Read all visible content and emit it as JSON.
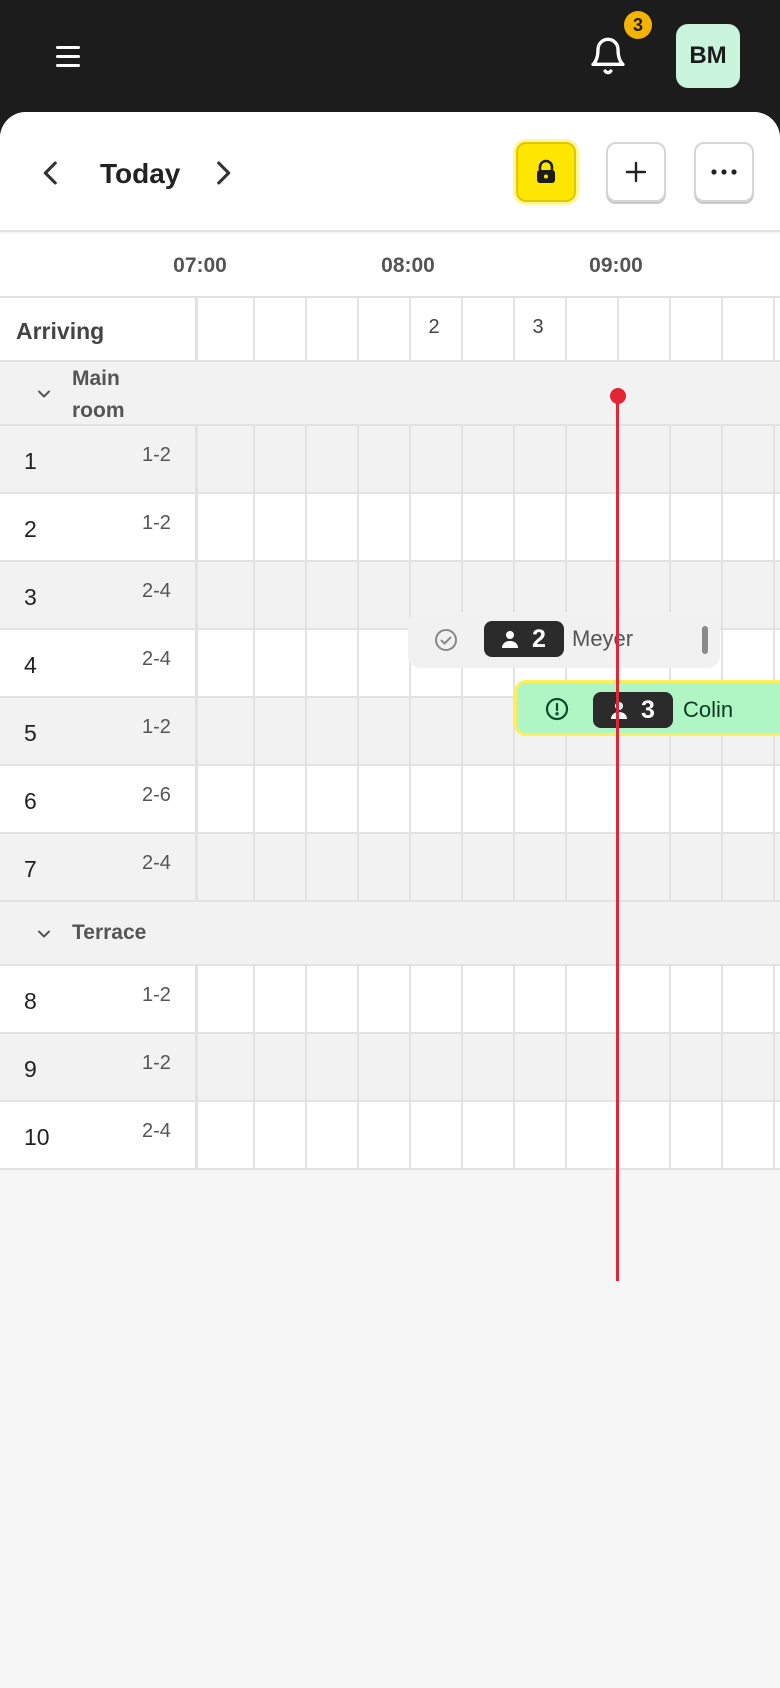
{
  "header": {
    "notification_count": "3",
    "avatar_initials": "BM"
  },
  "toolbar": {
    "date_label": "Today"
  },
  "timeline": {
    "times": [
      "07:00",
      "08:00",
      "09:00"
    ]
  },
  "arriving": {
    "label": "Arriving",
    "counts": [
      "2",
      "3"
    ]
  },
  "sections": [
    {
      "title_line1": "Main",
      "title_line2": "room",
      "tables": [
        {
          "name": "1",
          "capacity": "1-2"
        },
        {
          "name": "2",
          "capacity": "1-2"
        },
        {
          "name": "3",
          "capacity": "2-4"
        },
        {
          "name": "4",
          "capacity": "2-4"
        },
        {
          "name": "5",
          "capacity": "1-2"
        },
        {
          "name": "6",
          "capacity": "2-6"
        },
        {
          "name": "7",
          "capacity": "2-4"
        }
      ]
    },
    {
      "title_line1": "Terrace",
      "tables": [
        {
          "name": "8",
          "capacity": "1-2"
        },
        {
          "name": "9",
          "capacity": "1-2"
        },
        {
          "name": "10",
          "capacity": "2-4"
        }
      ]
    }
  ],
  "bookings": [
    {
      "guest_name": "Meyer",
      "guests": "2",
      "status_icon": "check-circle-icon"
    },
    {
      "guest_name": "Colin",
      "guests": "3",
      "status_icon": "alert-circle-icon"
    }
  ],
  "colors": {
    "accent_yellow": "#ffe600",
    "booking_green": "#b0f5c4",
    "now_line": "#e32636",
    "badge": "#f5b301"
  }
}
